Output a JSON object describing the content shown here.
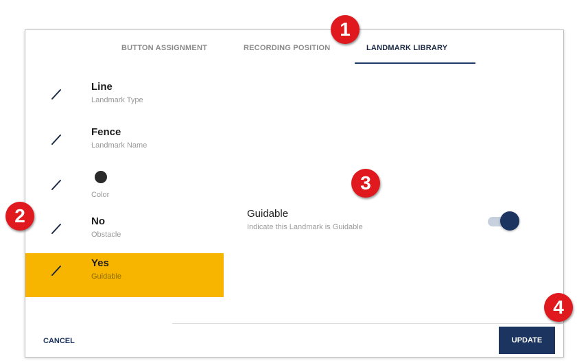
{
  "tabs": [
    {
      "label": "BUTTON ASSIGNMENT",
      "active": false
    },
    {
      "label": "RECORDING POSITION",
      "active": false
    },
    {
      "label": "LANDMARK LIBRARY",
      "active": true
    }
  ],
  "properties": [
    {
      "title": "Line",
      "subtitle": "Landmark Type",
      "icon": "pencil-icon"
    },
    {
      "title": "Fence",
      "subtitle": "Landmark Name",
      "icon": "pencil-icon"
    },
    {
      "title": "",
      "subtitle": "Color",
      "icon": "pencil-icon",
      "color_value": "#2a2a2a"
    },
    {
      "title": "No",
      "subtitle": "Obstacle",
      "icon": "pencil-icon"
    },
    {
      "title": "Yes",
      "subtitle": "Guidable",
      "icon": "pencil-icon",
      "selected": true
    }
  ],
  "guidable": {
    "title": "Guidable",
    "description": "Indicate this Landmark is Guidable",
    "toggle_on": true
  },
  "buttons": {
    "cancel": "CANCEL",
    "update": "UPDATE"
  },
  "markers": [
    "1",
    "2",
    "3",
    "4"
  ],
  "colors": {
    "accent_selected": "#f7b500",
    "primary": "#1b3460",
    "marker": "#e0191e"
  }
}
